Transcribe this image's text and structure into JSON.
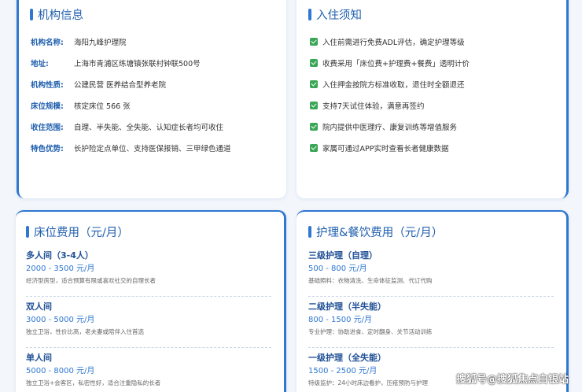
{
  "institution": {
    "title": "机构信息",
    "rows": [
      {
        "label": "机构名称:",
        "value": "海阳九峰护理院"
      },
      {
        "label": "地址:",
        "value": "上海市青浦区练塘镇张联村钟联500号"
      },
      {
        "label": "机构性质:",
        "value": "公建民营 医养结合型养老院"
      },
      {
        "label": "床位规模:",
        "value": "核定床位 566 张"
      },
      {
        "label": "收住范围:",
        "value": "自理、半失能、全失能、认知症长者均可收住"
      },
      {
        "label": "特色优势:",
        "value": "长护险定点单位、支持医保报销、三甲绿色通道"
      }
    ]
  },
  "notice": {
    "title": "入住须知",
    "items": [
      "入住前需进行免费ADL评估，确定护理等级",
      "收费采用「床位费+护理费+餐费」透明计价",
      "入住押金按院方标准收取，退住时全额退还",
      "支持7天试住体验，满意再签约",
      "院内提供中医理疗、康复训练等增值服务",
      "家属可通过APP实时查看长者健康数据"
    ]
  },
  "bed_fees": {
    "title": "床位费用（元/月）",
    "items": [
      {
        "name": "多人间（3-4人）",
        "price": "2000 - 3500 元/月",
        "desc": "经济型房型，适合预算有限或喜欢社交的自理长者"
      },
      {
        "name": "双人间",
        "price": "3000 - 5000 元/月",
        "desc": "独立卫浴，性价比高，老夫妻或陪伴入住首选"
      },
      {
        "name": "单人间",
        "price": "5000 - 8000 元/月",
        "desc": "独立卫浴+会客区，私密性好，适合注重隐私的长者"
      }
    ]
  },
  "care_fees": {
    "title": "护理&餐饮费用（元/月）",
    "items": [
      {
        "name": "三级护理（自理）",
        "price": "500 - 800 元/月",
        "desc": "基础照料：衣物清洗、生命体征监测、代订代购"
      },
      {
        "name": "二级护理（半失能）",
        "price": "800 - 1500 元/月",
        "desc": "专业护理：协助进食、定时翻身、关节活动训练"
      },
      {
        "name": "一级护理（全失能）",
        "price": "1500 - 2500 元/月",
        "desc": "特级监护：24小时床边看护，压疮预防与护理"
      }
    ]
  },
  "watermark": "搜狐号@搜狐焦点白银站",
  "colors": {
    "accent": "#2f77d0",
    "title": "#1f5fae",
    "check": "#3aa657"
  }
}
